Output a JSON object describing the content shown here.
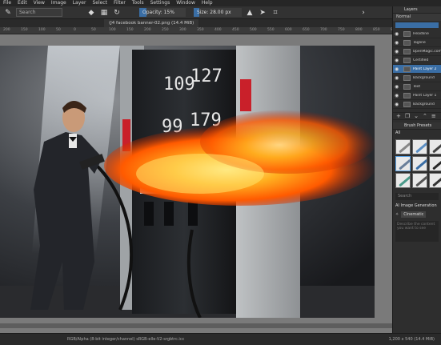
{
  "menu": [
    "File",
    "Edit",
    "View",
    "Image",
    "Layer",
    "Select",
    "Filter",
    "Tools",
    "Settings",
    "Window",
    "Help"
  ],
  "toolbar": {
    "preset_placeholder": "Search",
    "opacity": "Opacity: 15%",
    "opacity_fraction": 0.15,
    "size": "Size: 28.00 px",
    "size_fraction": 0.12
  },
  "document_tab": "(J4 facebook banner-02.png (14.4 MiB)",
  "ruler_ticks": [
    "200",
    "150",
    "100",
    "50",
    "0",
    "50",
    "100",
    "150",
    "200",
    "250",
    "300",
    "350",
    "400",
    "450",
    "500",
    "550",
    "600",
    "650",
    "700",
    "750",
    "800",
    "850",
    "900"
  ],
  "layers": {
    "title": "Layers",
    "blend_mode": "Normal",
    "items": [
      {
        "name": "Headline",
        "selected": false
      },
      {
        "name": "Tagline",
        "selected": false
      },
      {
        "name": "OpenMagic.com",
        "selected": false
      },
      {
        "name": "Certified",
        "selected": false
      },
      {
        "name": "Paint Layer 2",
        "selected": true
      },
      {
        "name": "Background",
        "selected": false
      },
      {
        "name": "Text",
        "selected": false
      },
      {
        "name": "Paint Layer 1",
        "selected": false
      },
      {
        "name": "Background",
        "selected": false
      }
    ]
  },
  "brushes": {
    "title": "Brush Presets",
    "tag": "All",
    "search_placeholder": "Search"
  },
  "ai": {
    "title": "AI Image Generation",
    "style": "Cinematic",
    "prompt_placeholder": "Describe the content you want to see"
  },
  "status": {
    "color_space": "RGB/Alpha (8-bit integer/channel)  sRGB-elle-V2-srgbtrc.icc",
    "dimensions": "1,200 x 540 (14.4 MiB)"
  },
  "colors": {
    "accent": "#3a6ea5",
    "fire": "#ff6a00",
    "panel": "#2e2e2e"
  }
}
